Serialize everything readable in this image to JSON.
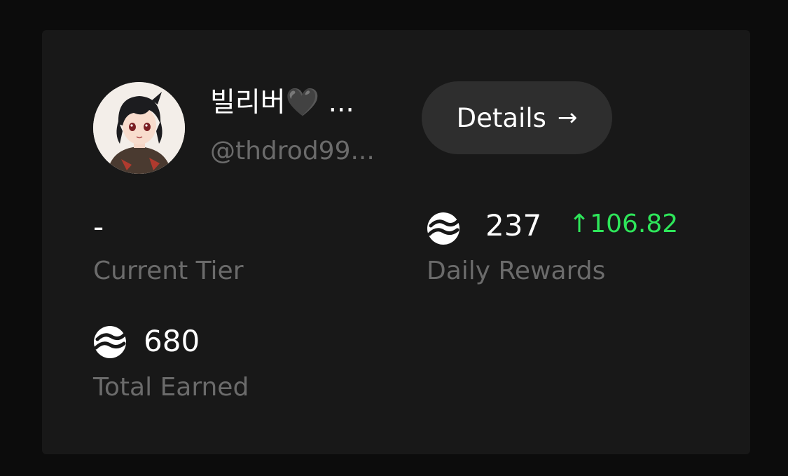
{
  "profile": {
    "display_name": "빌리버🖤 ...",
    "handle": "@thdrod99..."
  },
  "details_button": {
    "label": "Details",
    "arrow": "→",
    "icon": "arrow-right-icon"
  },
  "stats": {
    "current_tier": {
      "value": "-",
      "label": "Current Tier"
    },
    "daily_rewards": {
      "value": "237",
      "change": "↑106.82",
      "label": "Daily Rewards",
      "icon": "token-coin-icon"
    },
    "total_earned": {
      "value": "680",
      "label": "Total Earned",
      "icon": "token-coin-icon"
    }
  },
  "colors": {
    "background": "#0c0c0c",
    "card": "#181818",
    "button": "#2e2e2e",
    "muted_text": "#6b6b6b",
    "positive": "#2ee65a"
  }
}
